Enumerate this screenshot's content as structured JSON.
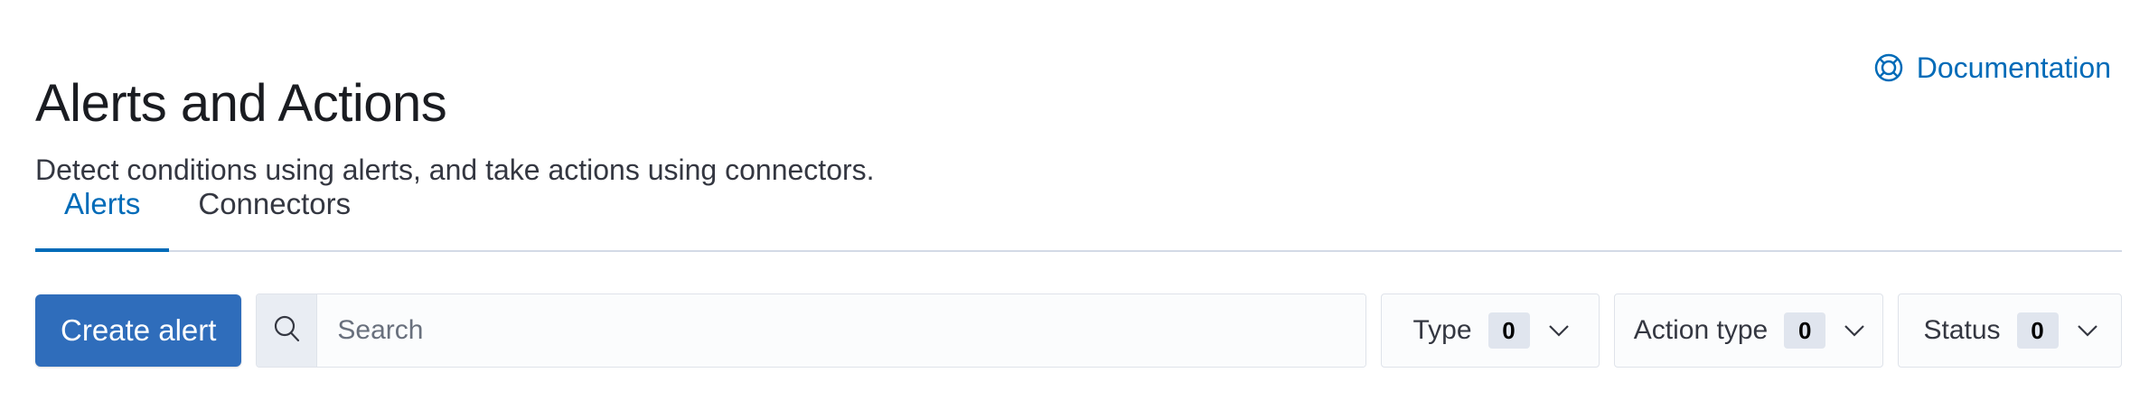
{
  "header": {
    "title": "Alerts and Actions",
    "description": "Detect conditions using alerts, and take actions using connectors.",
    "documentation_link": {
      "label": "Documentation",
      "icon": "help-lifebuoy-icon"
    }
  },
  "tabs": [
    {
      "label": "Alerts",
      "selected": true
    },
    {
      "label": "Connectors",
      "selected": false
    }
  ],
  "toolbar": {
    "create_label": "Create alert",
    "search": {
      "placeholder": "Search",
      "value": "",
      "icon": "search-icon"
    },
    "filters": [
      {
        "label": "Type",
        "count": "0"
      },
      {
        "label": "Action type",
        "count": "0"
      },
      {
        "label": "Status",
        "count": "0"
      }
    ]
  },
  "colors": {
    "accent": "#006bb8",
    "primary_button": "#2f6dbb",
    "border": "#d3dae6"
  }
}
